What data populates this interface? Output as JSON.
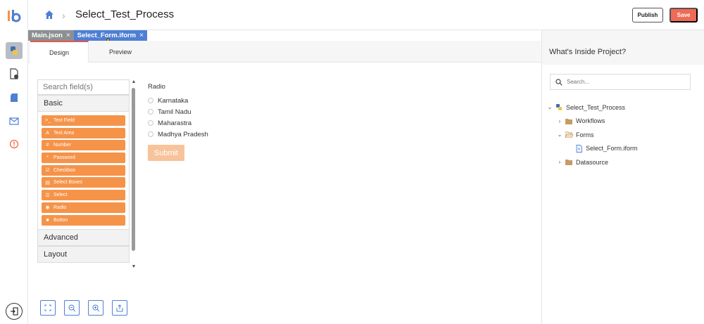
{
  "header": {
    "project_title": "Select_Test_Process",
    "publish_label": "Publish",
    "save_label": "Save"
  },
  "file_tabs": [
    {
      "label": "Main.json",
      "close": "×"
    },
    {
      "label": "Select_Form.iform",
      "close": "×"
    }
  ],
  "design_tabs": {
    "design": "Design",
    "preview": "Preview"
  },
  "palette": {
    "search_placeholder": "Search field(s)",
    "basic_label": "Basic",
    "components": [
      {
        "label": "Text Field",
        "glyph": ">_"
      },
      {
        "label": "Text Area",
        "glyph": "A"
      },
      {
        "label": "Number",
        "glyph": "#"
      },
      {
        "label": "Password",
        "glyph": "*"
      },
      {
        "label": "Checkbox",
        "glyph": "☑"
      },
      {
        "label": "Select Boxes",
        "glyph": "▤"
      },
      {
        "label": "Select",
        "glyph": "☰"
      },
      {
        "label": "Radio",
        "glyph": "◉"
      },
      {
        "label": "Button",
        "glyph": "■"
      }
    ],
    "advanced_label": "Advanced",
    "layout_label": "Layout"
  },
  "form": {
    "radio_label": "Radio",
    "options": [
      "Karnataka",
      "Tamil Nadu",
      "Maharastra",
      "Madhya Pradesh"
    ],
    "submit_label": "Submit"
  },
  "right_panel": {
    "title": "What's Inside Project?",
    "search_placeholder": "Search...",
    "tree": [
      {
        "label": "Select_Test_Process"
      },
      {
        "label": "Workflows"
      },
      {
        "label": "Forms"
      },
      {
        "label": "Select_Form.iform"
      },
      {
        "label": "Datasource"
      }
    ]
  },
  "colors": {
    "accent_orange": "#f59349",
    "save_red": "#f06a55",
    "active_tab_blue": "#4f7fd4",
    "tab_underline": "#e05a46"
  }
}
